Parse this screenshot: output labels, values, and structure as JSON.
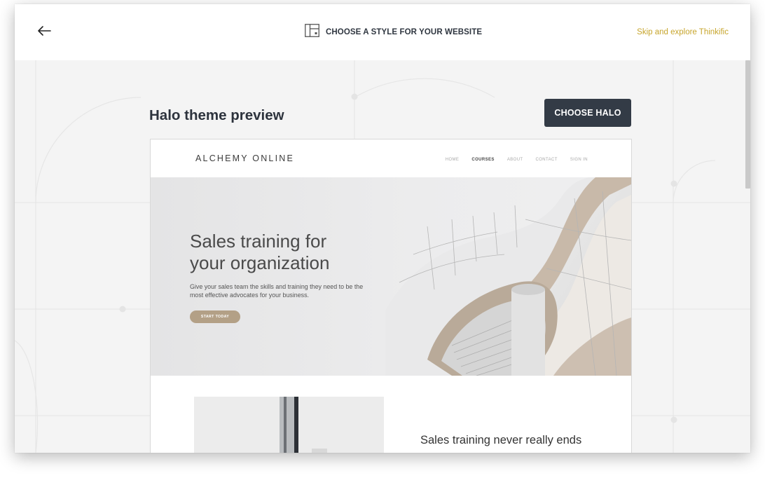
{
  "topbar": {
    "back_icon": "arrow-left-icon",
    "layout_icon": "layout-template-icon",
    "title": "CHOOSE A STYLE FOR YOUR WEBSITE",
    "skip_link": "Skip and explore Thinkific"
  },
  "preview": {
    "heading": "Halo theme preview",
    "choose_button": "CHOOSE HALO"
  },
  "site": {
    "logo": "ALCHEMY ONLINE",
    "nav": [
      {
        "label": "HOME",
        "active": false
      },
      {
        "label": "COURSES",
        "active": true
      },
      {
        "label": "ABOUT",
        "active": false
      },
      {
        "label": "CONTACT",
        "active": false
      },
      {
        "label": "SIGN IN",
        "active": false
      }
    ],
    "hero": {
      "title": "Sales training for\nyour organization",
      "text": "Give your sales team the skills and training they need to be the most effective advocates for your business.",
      "button": "START TODAY"
    },
    "section_heading": "Sales training never really ends"
  },
  "colors": {
    "accent_link": "#c7a52c",
    "primary_button": "#333b46",
    "hero_button": "#b3a086"
  }
}
